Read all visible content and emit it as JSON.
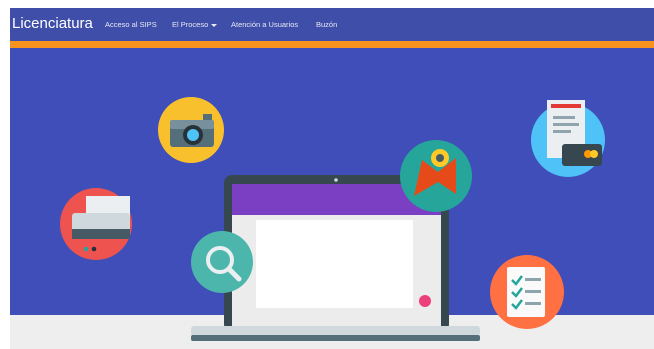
{
  "navbar": {
    "brand": "Licenciatura",
    "items": [
      {
        "label": "Acceso al SIPS"
      },
      {
        "label": "El Proceso"
      },
      {
        "label": "Atención a Usuarios"
      },
      {
        "label": "Buzón"
      }
    ]
  },
  "hero": {
    "illustration": "laptop with floating icons: camera, printer, search, map-pin, receipt/payment, checklist"
  },
  "colors": {
    "navbar_bg": "#3f4ea8",
    "accent_bar": "#f7931e",
    "hero_bg": "#3f4eb8"
  }
}
